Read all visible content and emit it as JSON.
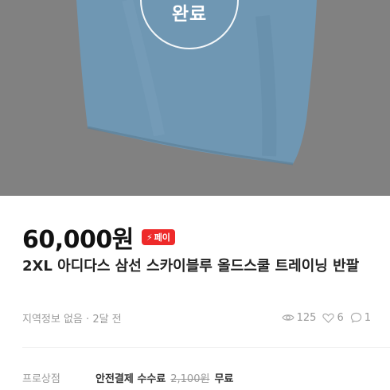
{
  "listing": {
    "sold_badge": "완료",
    "price": "60,000원",
    "pay_badge": "페이",
    "title": "2XL 아디다스 삼선 스카이블루 올드스쿨 트레이닝 반팔",
    "location": "지역정보 없음",
    "posted": "2달 전",
    "views": "125",
    "likes": "6",
    "chats": "1"
  },
  "shipping": {
    "label": "프로상점",
    "name": "안전결제 수수료",
    "old_price": "2,100원",
    "free": "무료"
  },
  "colors": {
    "photo_bg": "#818181",
    "shirt": "#6f97b3",
    "pay_badge": "#ee2a2a"
  }
}
